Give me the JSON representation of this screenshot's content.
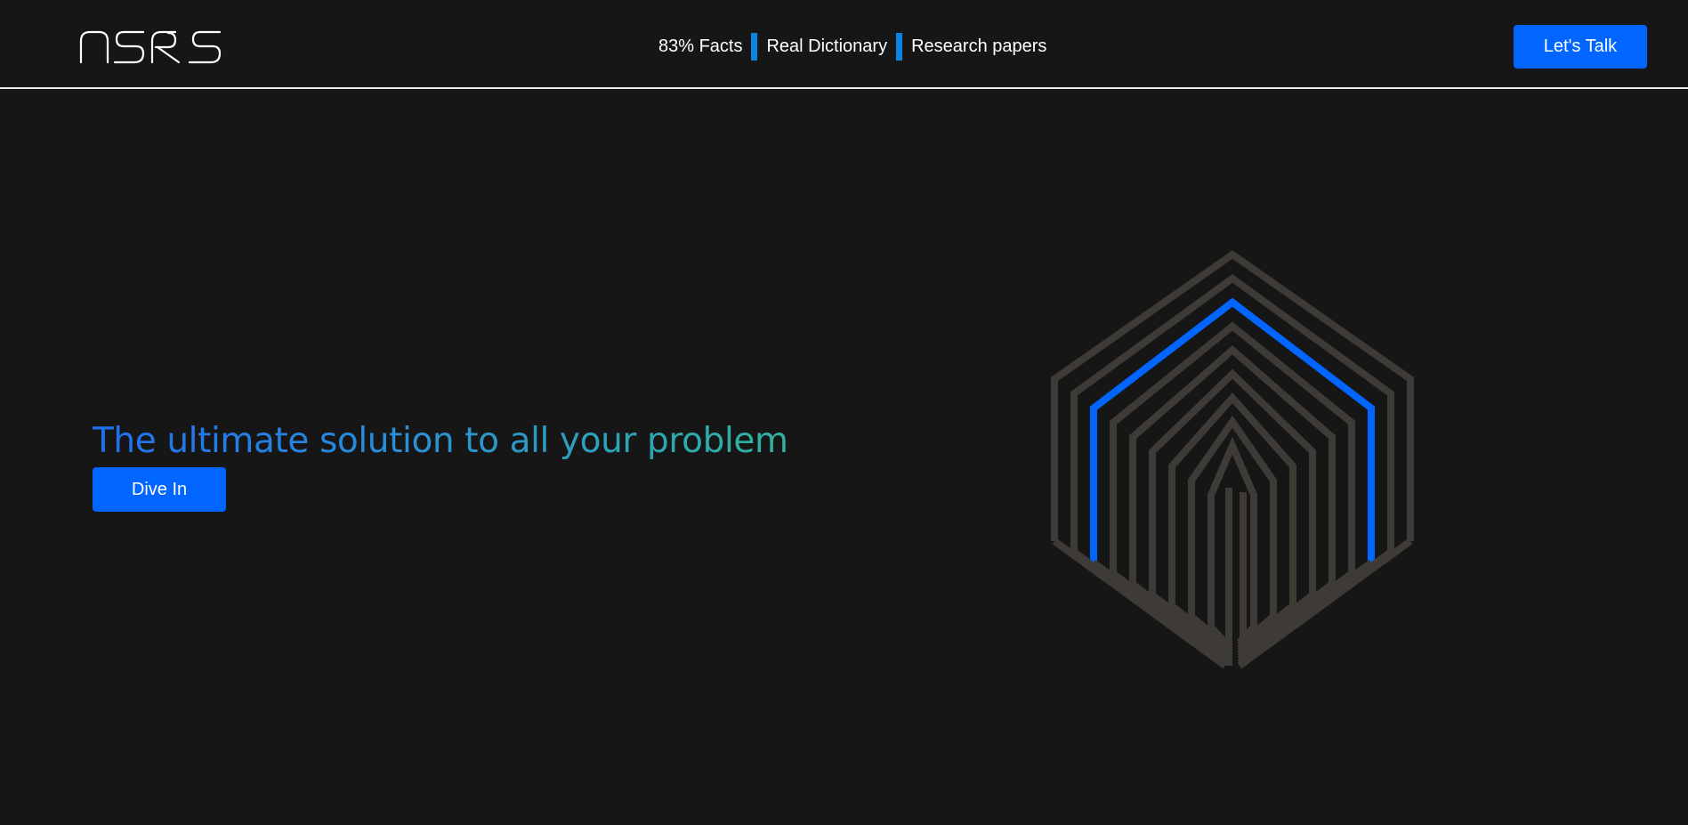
{
  "header": {
    "logo_text": "NSRS",
    "nav": [
      {
        "label": "83% Facts"
      },
      {
        "label": "Real Dictionary"
      },
      {
        "label": "Research papers"
      }
    ],
    "cta_label": "Let's Talk"
  },
  "hero": {
    "title": "The ultimate solution to all your problem",
    "button_label": "Dive In"
  },
  "colors": {
    "background": "#161616",
    "accent": "#0066ff",
    "separator": "#0b86e0",
    "cube_stroke": "#3e3b36",
    "cube_highlight": "#0066ff"
  }
}
